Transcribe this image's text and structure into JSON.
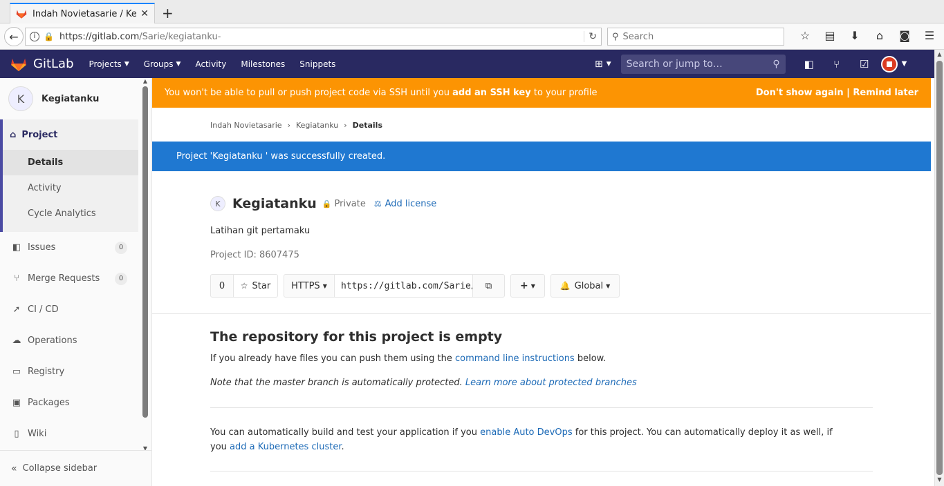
{
  "browser": {
    "tab_title": "Indah Novietasarie / Kegiatanku",
    "url_domain": "https://gitlab.com",
    "url_path": "/Sarie/kegiatanku-",
    "search_placeholder": "Search"
  },
  "header": {
    "brand": "GitLab",
    "nav": [
      {
        "label": "Projects",
        "dropdown": true
      },
      {
        "label": "Groups",
        "dropdown": true
      },
      {
        "label": "Activity"
      },
      {
        "label": "Milestones"
      },
      {
        "label": "Snippets"
      }
    ],
    "search_placeholder": "Search or jump to…"
  },
  "sidebar": {
    "project_initial": "K",
    "project_name": "Kegiatanku",
    "section": "Project",
    "sub_items": [
      "Details",
      "Activity",
      "Cycle Analytics"
    ],
    "items": [
      {
        "label": "Issues",
        "count": "0",
        "icon": "issues-icon"
      },
      {
        "label": "Merge Requests",
        "count": "0",
        "icon": "merge-request-icon"
      },
      {
        "label": "CI / CD",
        "icon": "rocket-icon"
      },
      {
        "label": "Operations",
        "icon": "cloud-gear-icon"
      },
      {
        "label": "Registry",
        "icon": "registry-icon"
      },
      {
        "label": "Packages",
        "icon": "package-icon"
      },
      {
        "label": "Wiki",
        "icon": "book-icon"
      }
    ],
    "collapse_label": "Collapse sidebar"
  },
  "banner": {
    "msg_pre": "You won't be able to pull or push project code via SSH until you ",
    "msg_link": "add an SSH key",
    "msg_post": " to your profile",
    "dont_show": "Don't show again",
    "separator": " | ",
    "remind": "Remind later"
  },
  "breadcrumb": {
    "items": [
      "Indah Novietasarie",
      "Kegiatanku"
    ],
    "current": "Details",
    "sep": "›"
  },
  "flash": "Project 'Kegiatanku ' was successfully created.",
  "project": {
    "initial": "K",
    "name": "Kegiatanku",
    "visibility": "Private",
    "add_license": "Add license",
    "description": "Latihan git pertamaku",
    "id_label": "Project ID: 8607475"
  },
  "controls": {
    "star_count": "0",
    "star_label": "Star",
    "protocol": "HTTPS",
    "clone_url": "https://gitlab.com/Sarie/kegiatanku-.git",
    "add_label": "+",
    "notification": "Global"
  },
  "empty": {
    "title": "The repository for this project is empty",
    "line1_pre": "If you already have files you can push them using the ",
    "line1_link": "command line instructions",
    "line1_post": " below.",
    "line2_pre": "Note that the master branch is automatically protected. ",
    "line2_link": "Learn more about protected branches",
    "autodevops_pre": "You can automatically build and test your application if you ",
    "autodevops_link1": "enable Auto DevOps",
    "autodevops_mid": " for this project. You can automatically deploy it as well, if you ",
    "autodevops_link2": "add a Kubernetes cluster",
    "autodevops_post": "."
  },
  "colors": {
    "header": "#292961",
    "banner": "#fc9403",
    "flash": "#1f78d1",
    "link": "#1b69b6"
  }
}
